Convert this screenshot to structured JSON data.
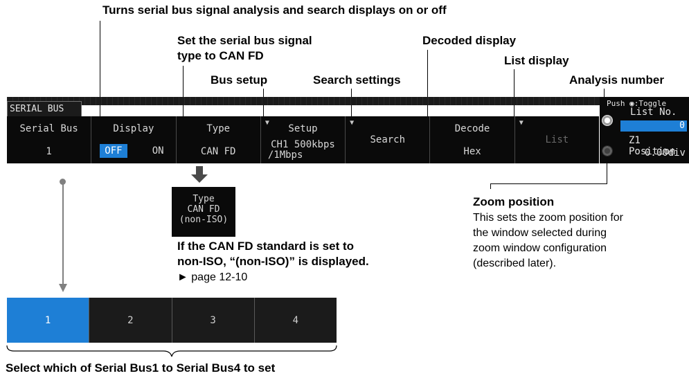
{
  "annotations": {
    "turns_serial": "Turns serial bus signal analysis and search displays on or off",
    "set_type_line1": "Set the serial bus signal",
    "set_type_line2": "type to CAN FD",
    "decoded_display": "Decoded display",
    "list_display": "List display",
    "bus_setup": "Bus setup",
    "search_settings": "Search settings",
    "analysis_number": "Analysis number",
    "zoom_position_title": "Zoom position",
    "zoom_desc_1": "This sets the zoom position for",
    "zoom_desc_2": "the window selected during",
    "zoom_desc_3": "zoom window configuration",
    "zoom_desc_4": "(described later).",
    "noniso_line1": "If the CAN FD standard is set to",
    "noniso_line2": "non-ISO, “(non-ISO)” is displayed.",
    "page_ref": "► page 12-10",
    "select_caption": "Select which of Serial Bus1 to Serial Bus4 to set"
  },
  "menu": {
    "tab_label": "SERIAL BUS",
    "serial_bus": {
      "title": "Serial Bus",
      "value": "1"
    },
    "display": {
      "title": "Display",
      "off": "OFF",
      "on": "ON"
    },
    "type": {
      "title": "Type",
      "value": "CAN FD"
    },
    "setup": {
      "title": "Setup",
      "value_line1": "CH1 500kbps",
      "value_line2": "/1Mbps"
    },
    "search": {
      "title": "Search"
    },
    "decode": {
      "title": "Decode",
      "value": "Hex"
    },
    "list": {
      "title": "List"
    }
  },
  "right_panel": {
    "push_toggle": "Push ◉:Toggle",
    "list_no_label": "List No.",
    "list_no_value": "0",
    "z1_position_label": "Z1 Position",
    "z1_position_value": "0.00div"
  },
  "popup": {
    "title": "Type",
    "line1": "CAN FD",
    "line2": "(non-ISO)"
  },
  "selector": {
    "items": [
      "1",
      "2",
      "3",
      "4"
    ],
    "active_index": 0
  },
  "colors": {
    "accent_blue": "#1e7fd6",
    "menu_bg": "#0a0a0a"
  }
}
